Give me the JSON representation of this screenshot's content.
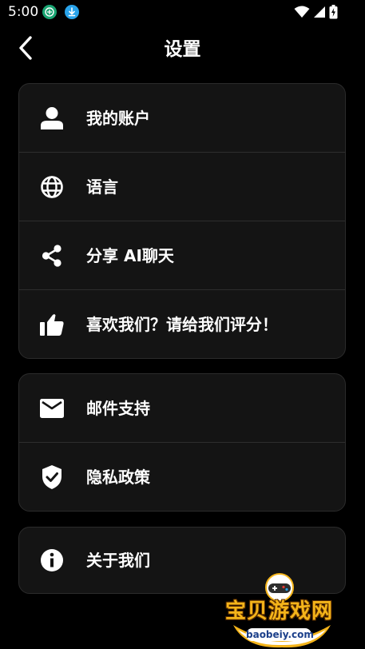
{
  "status_bar": {
    "time": "5:00",
    "icons": [
      "app-notification-icon",
      "download-icon",
      "wifi-icon",
      "cellular-signal-icon",
      "battery-charging-icon"
    ],
    "colors": {
      "notification_app": "#1aa572",
      "download": "#29a3ea"
    }
  },
  "header": {
    "title": "设置",
    "back_icon": "chevron-left-icon"
  },
  "settings": {
    "account_group": [
      {
        "id": "my-account",
        "icon": "person-icon",
        "label": "我的账户"
      },
      {
        "id": "language",
        "icon": "globe-icon",
        "label": "语言"
      },
      {
        "id": "share",
        "icon": "share-icon",
        "label": "分享 AI聊天"
      },
      {
        "id": "rate",
        "icon": "thumbs-up-icon",
        "label": "喜欢我们？请给我们评分！"
      }
    ],
    "support_group": [
      {
        "id": "email-support",
        "icon": "mail-icon",
        "label": "邮件支持"
      },
      {
        "id": "privacy-policy",
        "icon": "shield-check-icon",
        "label": "隐私政策"
      }
    ],
    "about_group": [
      {
        "id": "about-us",
        "icon": "info-icon",
        "label": "关于我们"
      }
    ]
  },
  "watermark": {
    "text": "宝贝游戏网",
    "url": "baobeiy.com"
  },
  "colors": {
    "background": "#000000",
    "card_background": "#141414",
    "card_border": "#2b2b2b",
    "text": "#ffffff",
    "watermark_gold": "#f4b41a"
  }
}
